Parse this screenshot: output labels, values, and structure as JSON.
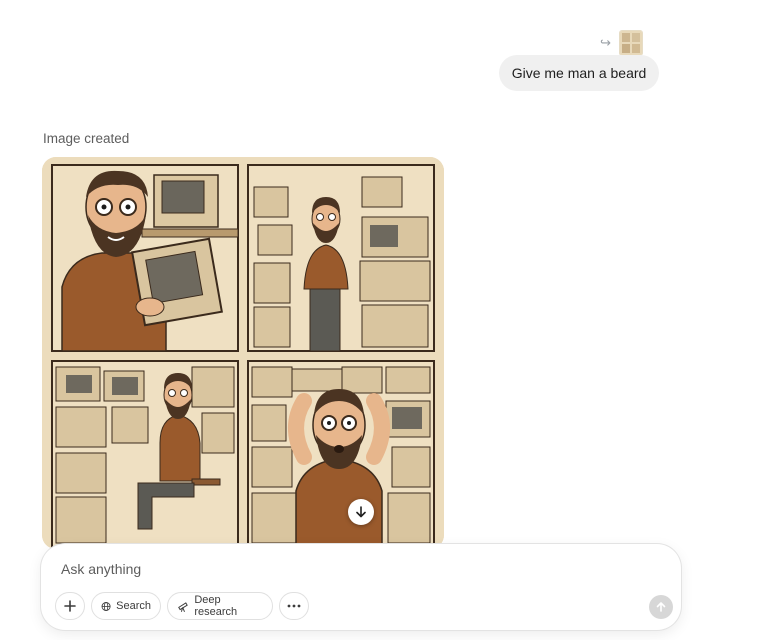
{
  "user_message": {
    "text": "Give me man a beard",
    "reply_icon": "reply-arrow-icon",
    "reply_glyph": "↪"
  },
  "assistant": {
    "image_label": "Image created",
    "download_icon": "download-icon"
  },
  "composer": {
    "placeholder": "Ask anything",
    "buttons": {
      "add_icon": "plus-icon",
      "search_label": "Search",
      "search_icon": "globe-icon",
      "deep_research_label": "Deep research",
      "deep_research_icon": "telescope-icon",
      "more_icon": "more-dots-icon",
      "send_icon": "arrow-up-icon"
    }
  },
  "colors": {
    "panel_bg": "#ecdcbc",
    "shirt": "#9a5a2c",
    "beard": "#4b3422",
    "skin": "#e7b68c",
    "computer": "#d9c59f"
  }
}
